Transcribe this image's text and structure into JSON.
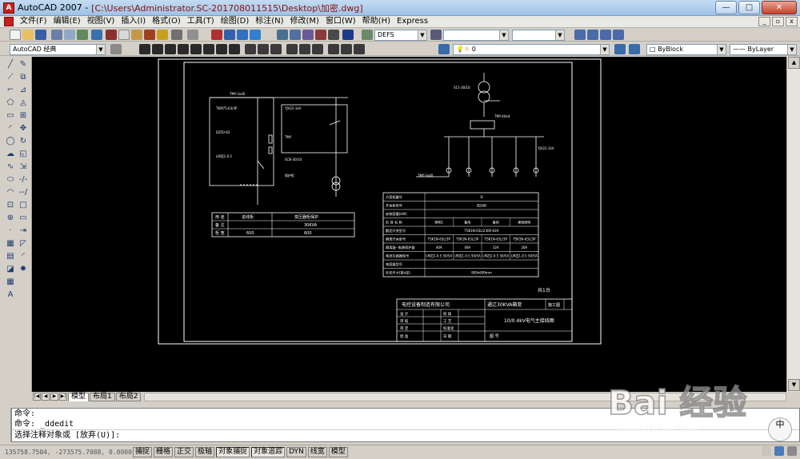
{
  "window": {
    "app_title": "AutoCAD 2007 - ",
    "file_title": "[C:\\Users\\Administrator.SC-201708011515\\Desktop\\加密.dwg]",
    "controls": {
      "minimize": "—",
      "maximize": "□",
      "close": "✕"
    }
  },
  "menu": [
    "文件(F)",
    "编辑(E)",
    "视图(V)",
    "插入(I)",
    "格式(O)",
    "工具(T)",
    "绘图(D)",
    "标注(N)",
    "修改(M)",
    "窗口(W)",
    "帮助(H)",
    "Express"
  ],
  "toolbar": {
    "text_style": "DEFS",
    "workspace": "AutoCAD 经典",
    "layer": "0",
    "color": "ByBlock",
    "linetype": "ByLayer"
  },
  "drawing": {
    "t1_headers": [
      "用 途",
      "进线柜",
      "变压器柜保护"
    ],
    "t1_rows": [
      [
        "备 注",
        "",
        "30KVA"
      ],
      [
        "柜 宽",
        "600",
        "600"
      ]
    ],
    "t2_cells": [
      [
        "方案柜编号",
        "D"
      ],
      [
        "开关柜型号",
        "低压柜"
      ],
      [
        "安装容量(kW)",
        ""
      ],
      [
        "负 荷 名 称",
        "照明1",
        "备用",
        "备用",
        "建筑照明"
      ],
      [
        "额定开关型号",
        "TSK1N-63L/2300-63A"
      ],
      [
        "隔离开关型号",
        "TSK1N-63L/3P",
        "TSK1N-63L/3P",
        "TSK1N-63L/3P",
        "TSK1N-63L/3P"
      ],
      [
        "隔离器--电源保护器",
        "40A",
        "40A",
        "32A",
        "20A"
      ],
      [
        "电流互感器型号",
        "LMZJ1-0.5 50/5A",
        "LMZJ1-0.5 50/5A",
        "LMZJ1-0.5 50/5A",
        "LMZJ1-0.5 50/5A"
      ],
      [
        "电容器型号",
        ""
      ],
      [
        "外形尺寸(宽x深)",
        "800x600mm"
      ]
    ],
    "sheet_count": "共1台",
    "company": "电控设备制造有限公司",
    "project": "通辽30KVA箱变",
    "part": "施工图",
    "drawing_title": "10/0.4kV电气主接线图",
    "tb_labels": [
      "设 计",
      "审 核",
      "审 定",
      "批 准"
    ],
    "tb_right": [
      "校 核",
      "工 艺",
      "标准化",
      "日 期"
    ],
    "drawing_no": "图 号"
  },
  "tabs": {
    "model": "模型",
    "layout1": "布局1",
    "layout2": "布局2"
  },
  "command": {
    "lines": [
      "命令:",
      "命令: _ddedit",
      "选择注释对象或 [放弃(U)]:"
    ]
  },
  "status": {
    "coords": "135758.7504, -273575.7088, 0.0000",
    "buttons": [
      "捕捉",
      "栅格",
      "正交",
      "极轴",
      "对象捕捉",
      "对象追踪",
      "DYN",
      "线宽",
      "模型"
    ]
  },
  "watermark": {
    "logo": "Bai 经验",
    "url": "jingyan.baidu.com"
  },
  "ime": "中"
}
